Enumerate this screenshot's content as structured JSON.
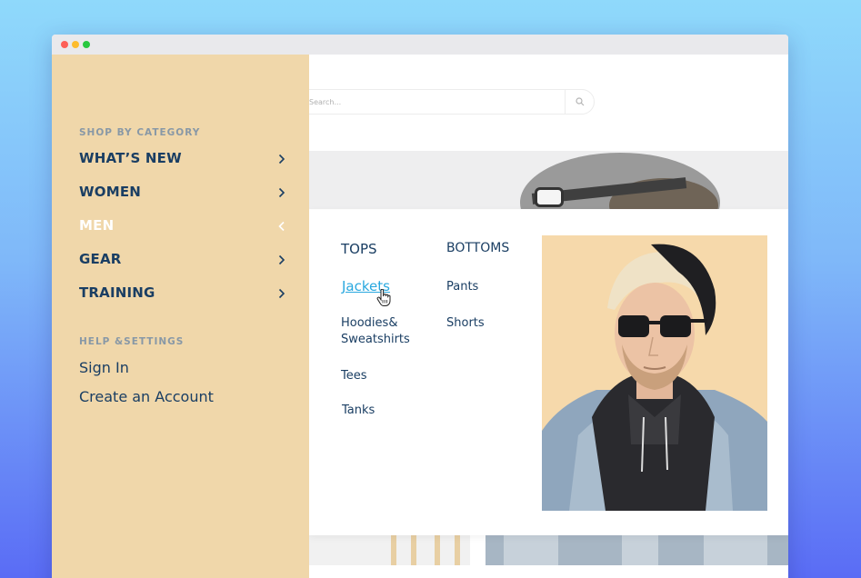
{
  "search": {
    "placeholder": "Search..."
  },
  "sidebar": {
    "section_title": "SHOP BY CATEGORY",
    "categories": [
      {
        "label": "WHAT’S NEW",
        "expanded": false
      },
      {
        "label": "WOMEN",
        "expanded": false
      },
      {
        "label": "MEN",
        "expanded": true
      },
      {
        "label": "GEAR",
        "expanded": false
      },
      {
        "label": "TRAINING",
        "expanded": false
      }
    ],
    "help_title": "HELP &SETTINGS",
    "help_links": [
      "Sign In",
      "Create an Account"
    ]
  },
  "mega": {
    "tops": {
      "title": "TOPS",
      "links": [
        "Jackets",
        "Hoodies&\nSweatshirts",
        "Tees",
        "Tanks"
      ]
    },
    "bottoms": {
      "title": "BOTTOMS",
      "links": [
        "Pants",
        "Shorts"
      ]
    }
  },
  "colors": {
    "sidebar_bg": "#f0d7aa",
    "text_navy": "#1a3e63",
    "active_link": "#29a8df",
    "label_gray": "#8898a6"
  },
  "icons": [
    "search-icon",
    "chevron-right-icon",
    "chevron-left-icon",
    "hand-cursor-icon"
  ]
}
